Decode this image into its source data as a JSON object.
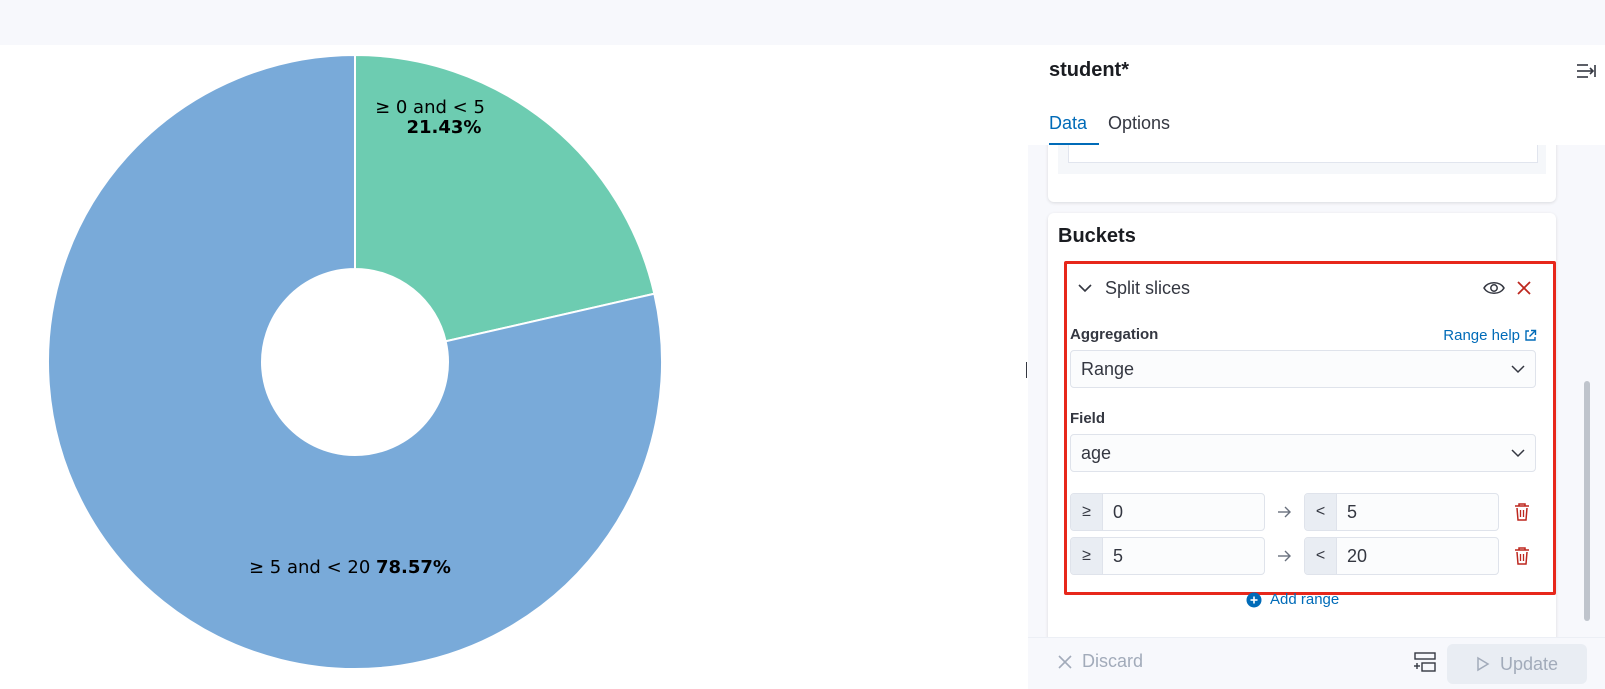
{
  "chart_data": {
    "type": "pie",
    "donut": true,
    "categories": [
      "≥ 0 and < 5",
      "≥ 5 and < 20"
    ],
    "values": [
      21.43,
      78.57
    ],
    "labels": [
      "21.43%",
      "78.57%"
    ],
    "colors": [
      "#6dccb1",
      "#79aad9"
    ]
  },
  "sidebar": {
    "index_title": "student*",
    "tabs": [
      "Data",
      "Options"
    ],
    "buckets": {
      "title": "Buckets",
      "panel_label": "Split slices",
      "aggregation_label": "Aggregation",
      "help_link": "Range help",
      "aggregation_value": "Range",
      "field_label": "Field",
      "field_value": "age",
      "ranges": [
        {
          "from_prefix": "≥",
          "from": "0",
          "to_prefix": "<",
          "to": "5"
        },
        {
          "from_prefix": "≥",
          "from": "5",
          "to_prefix": "<",
          "to": "20"
        }
      ],
      "add_range": "Add range"
    },
    "footer": {
      "discard": "Discard",
      "update": "Update"
    }
  },
  "icons": {
    "collapse": "collapse-sidebar-icon",
    "eye": "eye-icon",
    "close": "close-icon",
    "trash": "trash-icon",
    "plus": "plus-circle-icon",
    "arrow": "arrow-right-icon",
    "play": "play-icon",
    "cross": "cross-icon"
  },
  "colors": {
    "accent": "#006bb8",
    "danger": "#e7271b"
  }
}
